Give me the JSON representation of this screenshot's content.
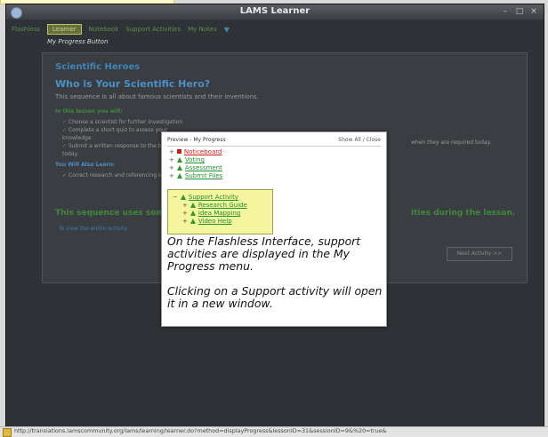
{
  "window": {
    "title": "LAMS Learner"
  },
  "nav": {
    "items": [
      "Flashless",
      "Learner",
      "Notebook",
      "Support Activities",
      "My Notes"
    ],
    "active_index": 1
  },
  "caption": "My Progress Button",
  "lesson": {
    "title": "Scientific Heroes",
    "heading": "Who is Your Scientific Hero?",
    "description": "This sequence is all about famous scientists and their inventions.",
    "subheading": "In this lesson you will:",
    "bullets": [
      "Choose a scientist for further investigation",
      "Complete a short quiz to assess your knowledge",
      "Submit a written response to the task"
    ],
    "bullets_more": "today.",
    "learn_heading": "You Will Also Learn:",
    "learn_bullet": "Correct research and referencing skills",
    "right_text": "when they are required today.",
    "sequence_left": "This sequence uses some",
    "sequence_right": "ities during the lesson.",
    "view_link": "To view the entire activity",
    "next_button": "Next Activity >>"
  },
  "popup": {
    "header_left": "Preview - My Progress",
    "header_right": "Show All / Close",
    "items": [
      {
        "label": "Noticeboard",
        "color": "#cc1b1b",
        "kind": "square"
      },
      {
        "label": "Voting",
        "color": "#1f8f2f",
        "kind": "triangle"
      },
      {
        "label": "Assessment",
        "color": "#1f8f2f",
        "kind": "triangle"
      },
      {
        "label": "Submit Files",
        "color": "#1f8f2f",
        "kind": "triangle"
      }
    ],
    "support": {
      "label": "Support Activity",
      "children": [
        "Research Guide",
        "Idea Mapping",
        "Video Help"
      ]
    },
    "text1": "On the Flashless Interface, support activities are displayed in the My Progress menu.",
    "text2": "Clicking on a Support activity will open it in a new window."
  },
  "status_bar": {
    "url": "http://translations.lamscommunity.org/lams/learning/learner.do?method=displayProgress&lessonID=31&sessionID=9&%20=true&"
  },
  "colors": {
    "accent_blue": "#4b90c6",
    "accent_green": "#3f8a3a",
    "highlight_yellow": "#f4f59c"
  }
}
